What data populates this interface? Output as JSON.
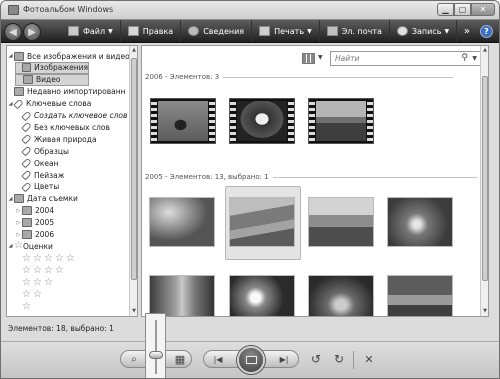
{
  "window": {
    "title": "Фотоальбом Windows",
    "controls": {
      "minimize": "▁",
      "maximize": "▢",
      "close": "✕"
    }
  },
  "nav": {
    "back": "◀",
    "forward": "▶"
  },
  "menu": {
    "items": [
      {
        "label": "Файл",
        "icon": "file-icon",
        "has_caret": true
      },
      {
        "label": "Правка",
        "icon": "edit-icon",
        "has_caret": false
      },
      {
        "label": "Сведения",
        "icon": "info-icon",
        "has_caret": false
      },
      {
        "label": "Печать",
        "icon": "print-icon",
        "has_caret": true
      },
      {
        "label": "Эл. почта",
        "icon": "email-icon",
        "has_caret": false
      },
      {
        "label": "Запись",
        "icon": "burn-icon",
        "has_caret": true
      }
    ],
    "overflow": "»",
    "help": "?"
  },
  "tree": {
    "items": [
      {
        "label": "Все изображения и видео",
        "indent": 0,
        "twisty": "◢",
        "icon": "folder",
        "selected": false,
        "italic": false
      },
      {
        "label": "Изображения",
        "indent": 1,
        "twisty": "",
        "icon": "folder",
        "selected": true,
        "italic": false
      },
      {
        "label": "Видео",
        "indent": 1,
        "twisty": "",
        "icon": "folder",
        "selected": true,
        "italic": false
      },
      {
        "label": "Недавно импортированн",
        "indent": 0,
        "twisty": "",
        "icon": "folder",
        "selected": false,
        "italic": false
      },
      {
        "label": "Ключевые слова",
        "indent": 0,
        "twisty": "◢",
        "icon": "tag",
        "selected": false,
        "italic": false
      },
      {
        "label": "Создать ключевое слов",
        "indent": 1,
        "twisty": "",
        "icon": "tag",
        "selected": false,
        "italic": true
      },
      {
        "label": "Без ключевых слов",
        "indent": 1,
        "twisty": "",
        "icon": "tag",
        "selected": false,
        "italic": false
      },
      {
        "label": "Живая природа",
        "indent": 1,
        "twisty": "",
        "icon": "tag",
        "selected": false,
        "italic": false
      },
      {
        "label": "Образцы",
        "indent": 1,
        "twisty": "",
        "icon": "tag",
        "selected": false,
        "italic": false
      },
      {
        "label": "Океан",
        "indent": 1,
        "twisty": "",
        "icon": "tag",
        "selected": false,
        "italic": false
      },
      {
        "label": "Пейзаж",
        "indent": 1,
        "twisty": "",
        "icon": "tag",
        "selected": false,
        "italic": false
      },
      {
        "label": "Цветы",
        "indent": 1,
        "twisty": "",
        "icon": "tag",
        "selected": false,
        "italic": false
      },
      {
        "label": "Дата съемки",
        "indent": 0,
        "twisty": "◢",
        "icon": "folder",
        "selected": false,
        "italic": false
      },
      {
        "label": "2004",
        "indent": 1,
        "twisty": "▷",
        "icon": "folder",
        "selected": false,
        "italic": false
      },
      {
        "label": "2005",
        "indent": 1,
        "twisty": "▷",
        "icon": "folder",
        "selected": false,
        "italic": false
      },
      {
        "label": "2006",
        "indent": 1,
        "twisty": "▷",
        "icon": "folder",
        "selected": false,
        "italic": false
      },
      {
        "label": "Оценки",
        "indent": 0,
        "twisty": "◢",
        "icon": "star",
        "selected": false,
        "italic": false
      }
    ],
    "ratings": [
      5,
      4,
      3,
      2,
      1
    ]
  },
  "search": {
    "placeholder": "Найти"
  },
  "groups": [
    {
      "header": "2006 - Элементов: 3"
    },
    {
      "header": "2005 - Элементов: 13, выбрано: 1"
    }
  ],
  "status": "Элементов: 18, выбрано: 1",
  "toolbar": {
    "zoom": "⌕",
    "thumbs": "▦",
    "prev": "|◀",
    "next": "▶|",
    "rotate_left": "↺",
    "rotate_right": "↻",
    "delete": "✕"
  }
}
